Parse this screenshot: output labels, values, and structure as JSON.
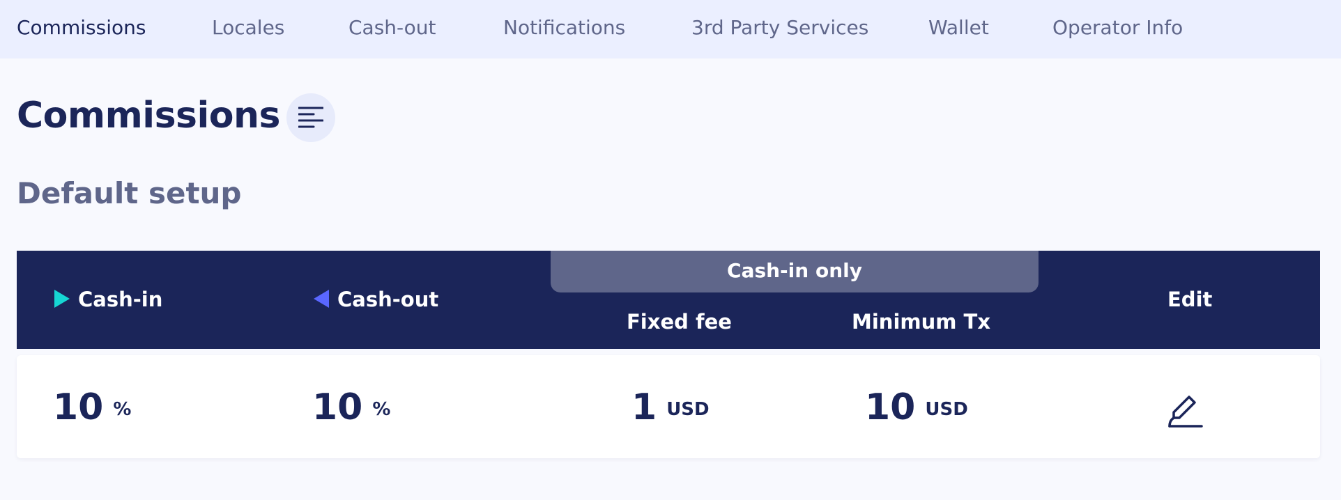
{
  "nav": {
    "tabs": [
      {
        "label": "Commissions",
        "active": true
      },
      {
        "label": "Locales"
      },
      {
        "label": "Cash-out"
      },
      {
        "label": "Notifications"
      },
      {
        "label": "3rd Party Services"
      },
      {
        "label": "Wallet"
      },
      {
        "label": "Operator Info"
      }
    ]
  },
  "page": {
    "title": "Commissions",
    "filter_icon": "sort-lines-icon"
  },
  "section": {
    "title": "Default setup"
  },
  "table": {
    "group_header": "Cash-in only",
    "columns": {
      "cash_in": "Cash-in",
      "cash_out": "Cash-out",
      "fixed_fee": "Fixed fee",
      "minimum_tx": "Minimum Tx",
      "edit": "Edit"
    },
    "row": {
      "cash_in": {
        "value": "10",
        "unit": "%"
      },
      "cash_out": {
        "value": "10",
        "unit": "%"
      },
      "fixed_fee": {
        "value": "1",
        "unit": "USD"
      },
      "minimum_tx": {
        "value": "10",
        "unit": "USD"
      },
      "edit_icon": "pencil-edit-icon"
    }
  },
  "colors": {
    "navy": "#1b2559",
    "slate": "#5f668a",
    "nav_bg": "#ebefff",
    "cash_in_marker": "#16d6d3",
    "cash_out_marker": "#5a67ff"
  }
}
